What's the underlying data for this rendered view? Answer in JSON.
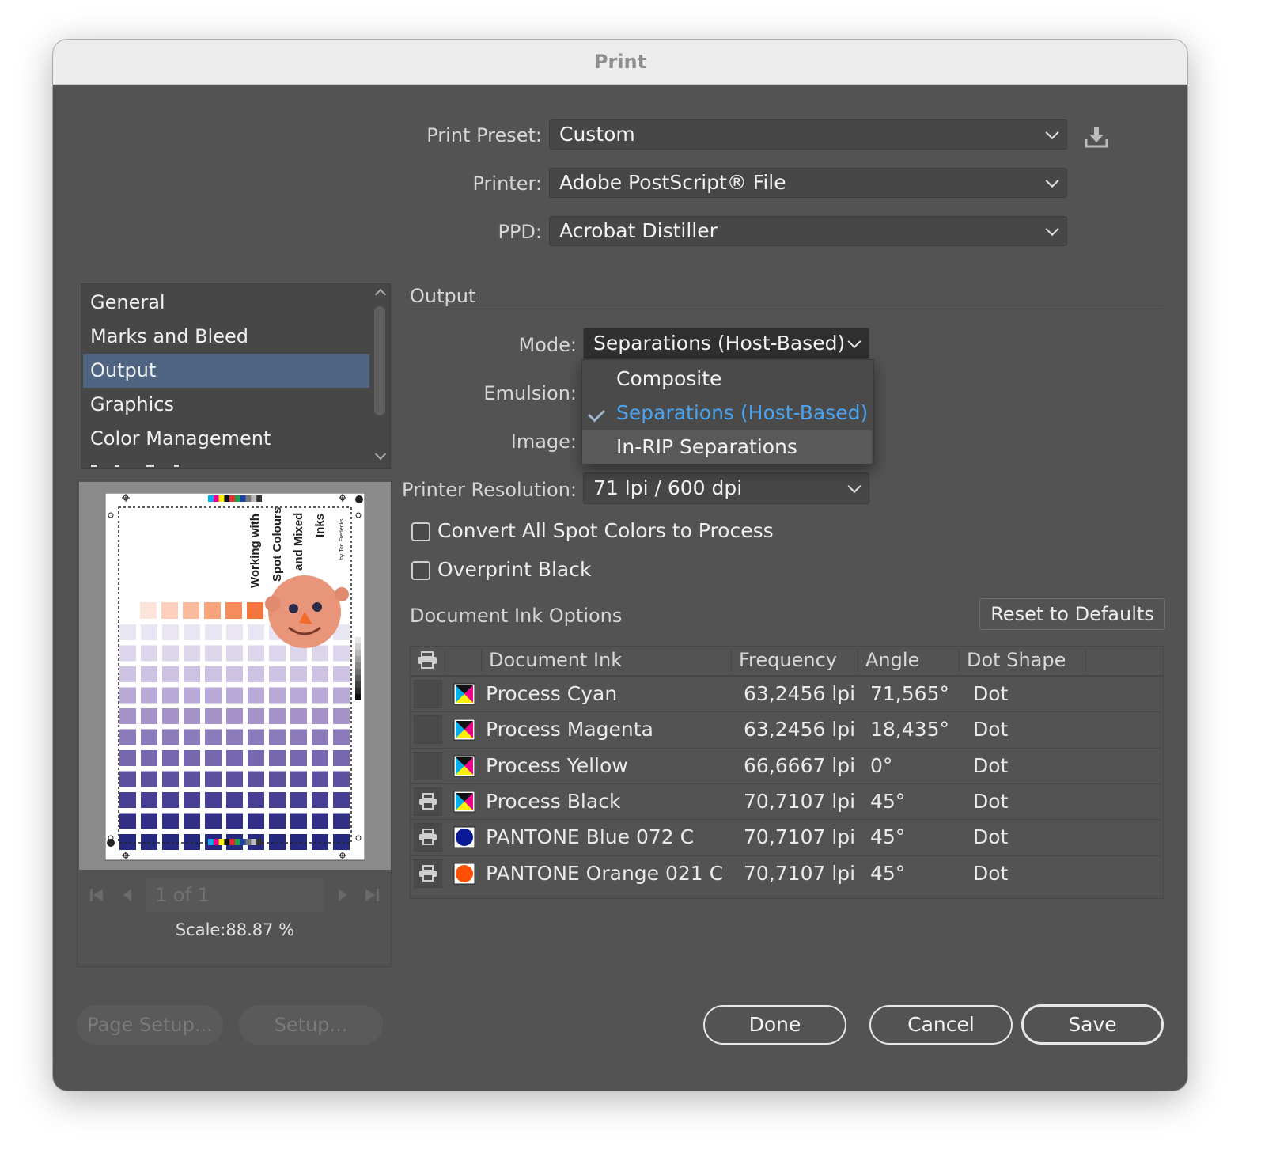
{
  "window": {
    "title": "Print"
  },
  "top": {
    "print_preset_label": "Print Preset:",
    "print_preset_value": "Custom",
    "printer_label": "Printer:",
    "printer_value": "Adobe PostScript® File",
    "ppd_label": "PPD:",
    "ppd_value": "Acrobat Distiller",
    "save_preset_icon": "download-icon"
  },
  "sidebar": {
    "items": [
      {
        "label": "General"
      },
      {
        "label": "Marks and Bleed"
      },
      {
        "label": "Output",
        "selected": true
      },
      {
        "label": "Graphics"
      },
      {
        "label": "Color Management"
      }
    ]
  },
  "preview": {
    "doc_title_lines": [
      "Working with",
      "Spot Colours",
      "and Mixed",
      "Inks"
    ],
    "doc_byline": "by Ton Frederiks",
    "page_field": "1 of 1",
    "scale": "Scale:88.87 %"
  },
  "output": {
    "section_title": "Output",
    "mode_label": "Mode:",
    "mode_value": "Separations (Host-Based)",
    "emulsion_label": "Emulsion:",
    "image_label": "Image:",
    "resolution_label": "Printer Resolution:",
    "resolution_value": "71 lpi / 600 dpi",
    "convert_spot_label": "Convert All Spot Colors to Process",
    "convert_spot_checked": false,
    "overprint_black_label": "Overprint Black",
    "overprint_black_checked": false,
    "mode_menu": {
      "options": [
        {
          "label": "Composite"
        },
        {
          "label": "Separations (Host-Based)",
          "checked": true
        },
        {
          "label": "In-RIP Separations",
          "highlighted": true
        }
      ]
    }
  },
  "inks": {
    "section_title": "Document Ink Options",
    "reset_button": "Reset to Defaults",
    "headers": {
      "ink": "Document Ink",
      "frequency": "Frequency",
      "angle": "Angle",
      "dot_shape": "Dot Shape"
    },
    "rows": [
      {
        "name": "Process Cyan",
        "frequency": "63,2456 lpi",
        "angle": "71,565°",
        "dot": "Dot",
        "print": false,
        "swatch": "process"
      },
      {
        "name": "Process Magenta",
        "frequency": "63,2456 lpi",
        "angle": "18,435°",
        "dot": "Dot",
        "print": false,
        "swatch": "process"
      },
      {
        "name": "Process Yellow",
        "frequency": "66,6667 lpi",
        "angle": "0°",
        "dot": "Dot",
        "print": false,
        "swatch": "process"
      },
      {
        "name": "Process Black",
        "frequency": "70,7107 lpi",
        "angle": "45°",
        "dot": "Dot",
        "print": true,
        "swatch": "process"
      },
      {
        "name": "PANTONE Blue 072 C",
        "frequency": "70,7107 lpi",
        "angle": "45°",
        "dot": "Dot",
        "print": true,
        "swatch": "#0a1a96"
      },
      {
        "name": "PANTONE Orange 021 C",
        "frequency": "70,7107 lpi",
        "angle": "45°",
        "dot": "Dot",
        "print": true,
        "swatch": "#fe5000"
      }
    ]
  },
  "footer": {
    "page_setup": "Page Setup...",
    "setup": "Setup...",
    "done": "Done",
    "cancel": "Cancel",
    "save": "Save"
  },
  "colors": {
    "dialog_bg": "#535353",
    "selection": "#4e6480",
    "menu_check": "#4aa3f0",
    "pantone_blue": "#0a1a96",
    "pantone_orange": "#fe5000"
  }
}
